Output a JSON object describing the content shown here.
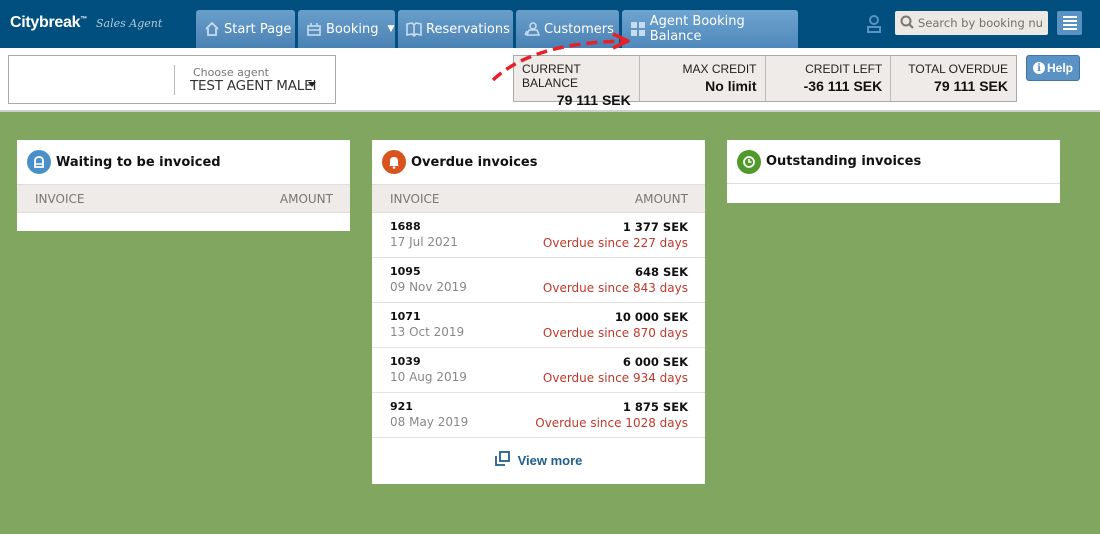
{
  "brand": {
    "name": "Citybreak",
    "trademark": "™",
    "subtitle": "Sales Agent"
  },
  "nav": {
    "tabs": [
      {
        "label": "Start Page",
        "icon": "home-icon"
      },
      {
        "label": "Booking",
        "icon": "suitcase-icon",
        "has_dropdown": true
      },
      {
        "label": "Reservations",
        "icon": "book-icon"
      },
      {
        "label": "Customers",
        "icon": "customers-icon"
      },
      {
        "label": "Agent Booking Balance",
        "icon": "grid-icon",
        "active": true
      }
    ],
    "search_placeholder": "Search by booking nu...",
    "user_icon": "user-icon",
    "menu_icon": "hamburger-icon"
  },
  "agent": {
    "label": "Choose agent",
    "value": "TEST AGENT MALEI"
  },
  "balance": [
    {
      "label": "CURRENT BALANCE",
      "value": "79 111 SEK"
    },
    {
      "label": "MAX CREDIT",
      "value": "No limit"
    },
    {
      "label": "CREDIT LEFT",
      "value": "-36 111 SEK"
    },
    {
      "label": "TOTAL OVERDUE",
      "value": "79 111 SEK"
    }
  ],
  "help_label": "Help",
  "panels": {
    "waiting": {
      "title": "Waiting to be invoiced",
      "col_invoice": "INVOICE",
      "col_amount": "AMOUNT",
      "icon_color": "#4a90c8"
    },
    "overdue": {
      "title": "Overdue invoices",
      "col_invoice": "INVOICE",
      "col_amount": "AMOUNT",
      "icon_color": "#d9531e",
      "rows": [
        {
          "invoice": "1688",
          "date": "17 Jul 2021",
          "amount": "1 377 SEK",
          "status": "Overdue since 227 days"
        },
        {
          "invoice": "1095",
          "date": "09 Nov 2019",
          "amount": "648 SEK",
          "status": "Overdue since 843 days"
        },
        {
          "invoice": "1071",
          "date": "13 Oct 2019",
          "amount": "10 000 SEK",
          "status": "Overdue since 870 days"
        },
        {
          "invoice": "1039",
          "date": "10 Aug 2019",
          "amount": "6 000 SEK",
          "status": "Overdue since 934 days"
        },
        {
          "invoice": "921",
          "date": "08 May 2019",
          "amount": "1 875 SEK",
          "status": "Overdue since 1028 days"
        }
      ],
      "view_more": "View more"
    },
    "outstanding": {
      "title": "Outstanding invoices",
      "icon_color": "#4f9a2a"
    }
  },
  "colors": {
    "navbar": "#004f7f",
    "tab": "#5a92c4",
    "background": "#80a660",
    "overdue_text": "#c0392b",
    "annotation_arrow": "#e8202a"
  }
}
